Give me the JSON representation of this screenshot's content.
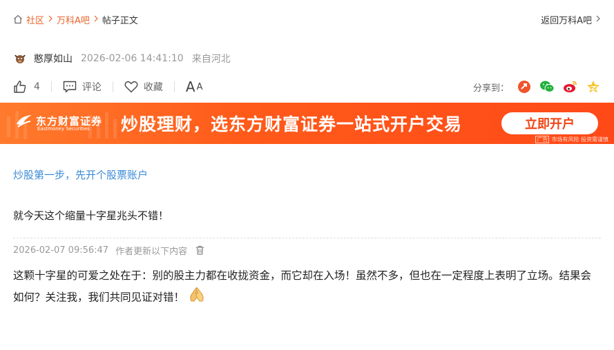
{
  "breadcrumb": {
    "home": "社区",
    "bar": "万科A吧",
    "current": "帖子正文",
    "back": "返回万科A吧"
  },
  "post": {
    "author": "憨厚如山",
    "time": "2026-02-06 14:41:10",
    "source": "来自河北",
    "title": "就今天这个缩量十字星兆头不错！",
    "update_time": "2026-02-07 09:56:47",
    "update_note": "作者更新以下内容",
    "body": "这颗十字星的可爱之处在于：别的股主力都在收拢资金，而它却在入场！虽然不多，但也在一定程度上表明了立场。结果会如何？关注我，我们共同见证对错！"
  },
  "actions": {
    "likes": "4",
    "comment": "评论",
    "favorite": "收藏",
    "font_big": "A",
    "font_small": "A",
    "share_label": "分享到："
  },
  "banner": {
    "brand_cn": "东方财富证券",
    "brand_en": "Eastmoney Securities",
    "slogan": "炒股理财，选东方财富证券一站式开户交易",
    "cta": "立即开户",
    "ad_tag": "广告",
    "risk": "市场有风险 投资需谨慎"
  },
  "promo_link": "炒股第一步，先开个股票账户",
  "colors": {
    "accent": "#e8642b",
    "link_blue": "#3a8ad8",
    "banner_orange": "#ff5a1a"
  }
}
